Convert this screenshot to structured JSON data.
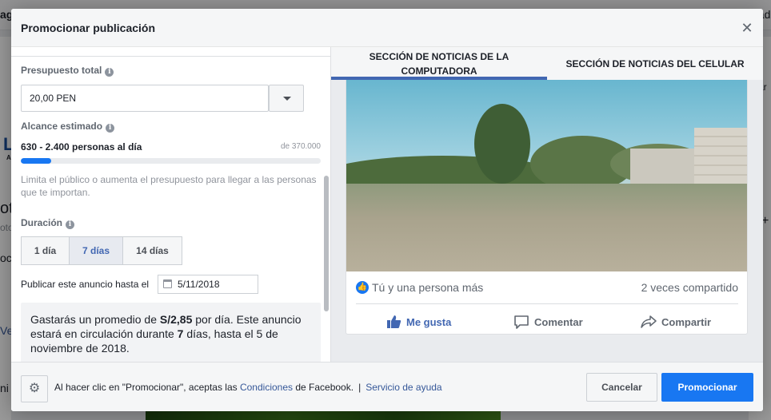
{
  "background": {
    "fragments": [
      "agi",
      "dad",
      "ote",
      "oto",
      "oci",
      "Ve",
      "ror",
      "ni",
      "L",
      "A",
      "ar",
      "+"
    ]
  },
  "modal": {
    "title": "Promocionar publicación",
    "close_glyph": "✕"
  },
  "budget": {
    "label": "Presupuesto total",
    "value": "20,00 PEN"
  },
  "reach": {
    "label": "Alcance estimado",
    "range_text": "630 - 2.400 personas al día",
    "max_text": "de 370.000",
    "fill_fraction": 0.1,
    "hint": "Limita el público o aumenta el presupuesto para llegar a las personas que te importan."
  },
  "duration": {
    "label": "Duración",
    "options": [
      "1 día",
      "7 días",
      "14 días"
    ],
    "selected_index": 1
  },
  "publish_until": {
    "label": "Publicar este anuncio hasta el",
    "date": "5/11/2018"
  },
  "summary": {
    "part1": "Gastarás un promedio de ",
    "amount": "S/2,85",
    "part2": " por día. Este anuncio estará en circulación durante ",
    "days": "7",
    "part3": " días, hasta el 5 de noviembre de 2018."
  },
  "preview": {
    "tabs": [
      "SECCIÓN DE NOTICIAS DE LA COMPUTADORA",
      "SECCIÓN DE NOTICIAS DEL CELULAR"
    ],
    "active_tab": 0,
    "reactors": "Tú y una persona más",
    "shares": "2 veces compartido",
    "actions": {
      "like": "Me gusta",
      "comment": "Comentar",
      "share": "Compartir"
    }
  },
  "footer": {
    "text_before": "Al hacer clic en \"Promocionar\", aceptas las ",
    "terms_link": "Condiciones",
    "text_after": " de Facebook.",
    "separator": "|",
    "help_link": "Servicio de ayuda",
    "cancel_label": "Cancelar",
    "promote_label": "Promocionar"
  },
  "colors": {
    "accent": "#1877f2",
    "tab_active": "#4267b2",
    "link": "#365899"
  }
}
